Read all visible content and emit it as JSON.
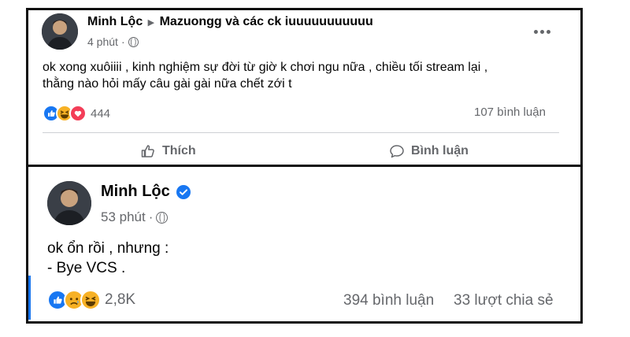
{
  "post1": {
    "author": "Minh Lộc",
    "group": "Mazuongg và các ck iuuuuuuuuuuu",
    "time": "4 phút",
    "content": "ok xong xuôiiii , kinh nghiệm sự đời từ giờ k chơi ngu nữa , chiều tối stream lại ,\nthằng nào hỏi mấy câu gài gài nữa chết zới t",
    "reaction_count": "444",
    "comments": "107 bình luận",
    "like_label": "Thích",
    "comment_label": "Bình luận",
    "more_icon": "more-dots-icon"
  },
  "post2": {
    "author": "Minh Lộc",
    "time": "53 phút",
    "verified": true,
    "content": "ok ổn rồi , nhưng :\n- Bye VCS .",
    "reaction_count": "2,8K",
    "comments": "394 bình luận",
    "shares": "33 lượt chia sẻ"
  },
  "colors": {
    "like_blue": "#1877f2",
    "haha_yellow": "#f7b125",
    "love_red": "#f33e58",
    "meta_gray": "#65676b"
  }
}
